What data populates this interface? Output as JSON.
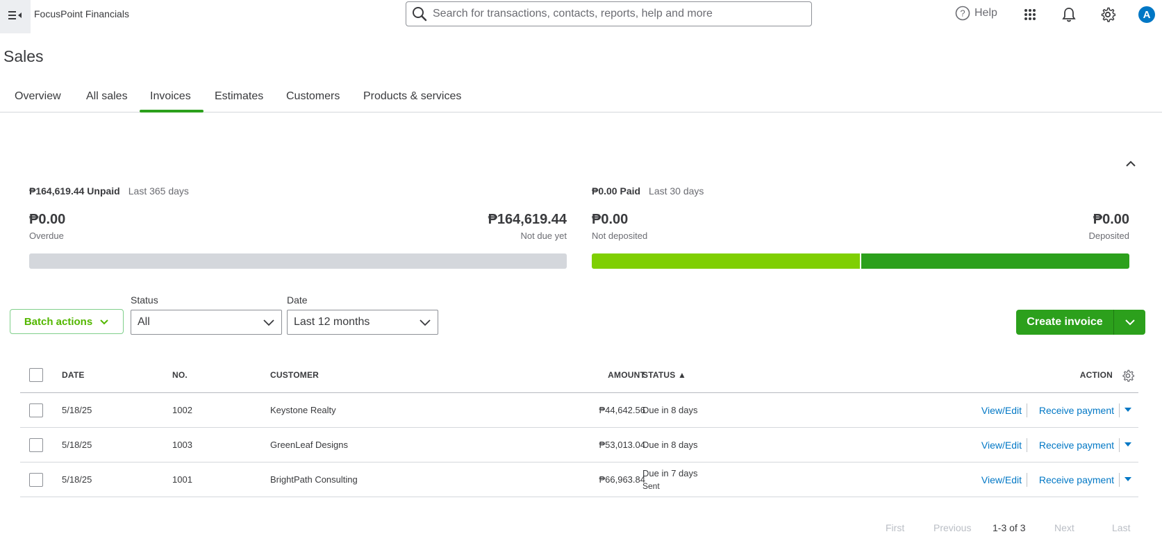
{
  "topbar": {
    "company": "FocusPoint Financials",
    "search_placeholder": "Search for transactions, contacts, reports, help and more",
    "help": "Help",
    "avatar_initial": "A"
  },
  "page": {
    "title": "Sales"
  },
  "tabs": [
    "Overview",
    "All sales",
    "Invoices",
    "Estimates",
    "Customers",
    "Products & services"
  ],
  "active_tab": "Invoices",
  "summary": {
    "unpaid": {
      "amount_label": "₱164,619.44 Unpaid",
      "period": "Last 365 days",
      "overdue_value": "₱0.00",
      "overdue_label": "Overdue",
      "notdue_value": "₱164,619.44",
      "notdue_label": "Not due yet"
    },
    "paid": {
      "amount_label": "₱0.00 Paid",
      "period": "Last 30 days",
      "notdeposited_value": "₱0.00",
      "notdeposited_label": "Not deposited",
      "deposited_value": "₱0.00",
      "deposited_label": "Deposited"
    },
    "colors": {
      "grey_bar": "#d4d7dc",
      "lime_bar": "#7fcf03",
      "green_bar": "#2ca01c"
    }
  },
  "filters": {
    "batch_actions": "Batch actions",
    "status_label": "Status",
    "status_value": "All",
    "date_label": "Date",
    "date_value": "Last 12 months"
  },
  "create_invoice": "Create invoice",
  "table": {
    "headers": {
      "date": "DATE",
      "no": "NO.",
      "customer": "CUSTOMER",
      "amount": "AMOUNT",
      "status": "STATUS ▲",
      "action": "ACTION"
    },
    "rows": [
      {
        "date": "5/18/25",
        "no": "1002",
        "customer": "Keystone Realty",
        "amount": "₱44,642.56",
        "status": "Due in 8 days",
        "substatus": "",
        "view": "View/Edit",
        "receive": "Receive payment"
      },
      {
        "date": "5/18/25",
        "no": "1003",
        "customer": "GreenLeaf Designs",
        "amount": "₱53,013.04",
        "status": "Due in 8 days",
        "substatus": "",
        "view": "View/Edit",
        "receive": "Receive payment"
      },
      {
        "date": "5/18/25",
        "no": "1001",
        "customer": "BrightPath Consulting",
        "amount": "₱66,963.84",
        "status": "Due in 7 days",
        "substatus": "Sent",
        "view": "View/Edit",
        "receive": "Receive payment"
      }
    ]
  },
  "pagination": {
    "first": "First",
    "previous": "Previous",
    "range": "1-3 of 3",
    "next": "Next",
    "last": "Last"
  },
  "accent_color": "#2ca01c",
  "link_color": "#0077c5"
}
